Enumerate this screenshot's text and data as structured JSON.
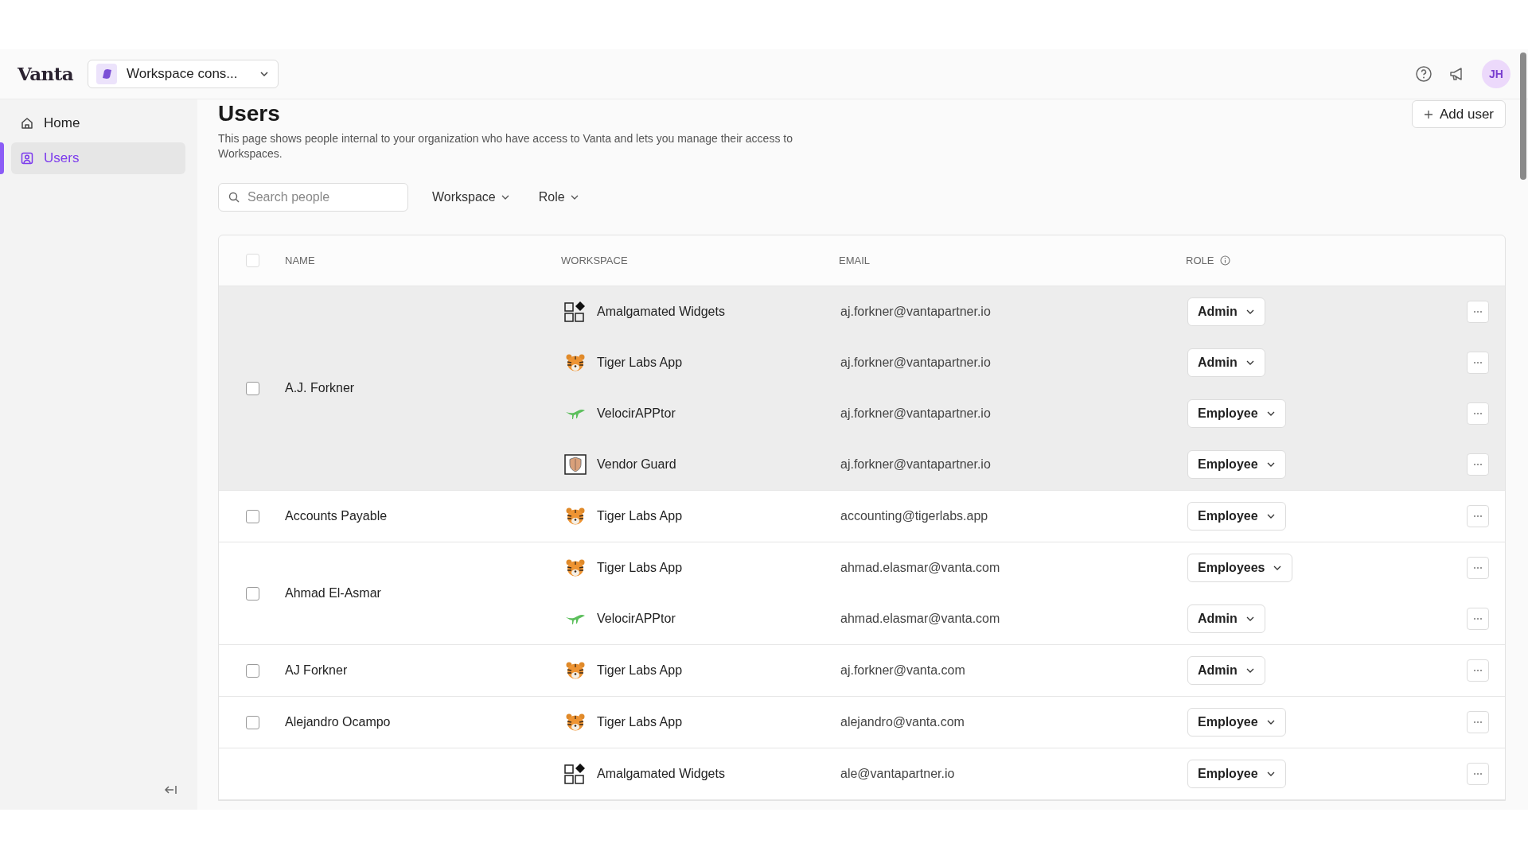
{
  "header": {
    "logo": "Vanta",
    "workspace": "Workspace cons...",
    "avatar": "JH"
  },
  "sidebar": {
    "items": [
      {
        "label": "Home",
        "kind": "home",
        "selected": false
      },
      {
        "label": "Users",
        "kind": "users",
        "selected": true
      }
    ]
  },
  "page": {
    "title": "Users",
    "description": "This page shows people internal to your organization who have access to Vanta and lets you manage their access to Workspaces.",
    "add_button": "Add user",
    "search": {
      "placeholder": "Search people"
    },
    "filters": [
      "Workspace",
      "Role"
    ]
  },
  "table": {
    "select_all": {
      "checked": false
    },
    "columns": [
      "NAME",
      "WORKSPACE",
      "EMAIL",
      "ROLE"
    ],
    "groups": [
      {
        "name": "A.J. Forkner",
        "checked": false,
        "highlighted": true,
        "memberships": [
          {
            "workspace": "Amalgamated Widgets",
            "kind": "grid",
            "email": "aj.forkner@vantapartner.io",
            "role": "Admin"
          },
          {
            "workspace": "Tiger Labs App",
            "kind": "tiger",
            "email": "aj.forkner@vantapartner.io",
            "role": "Admin"
          },
          {
            "workspace": "VelocirAPPtor",
            "kind": "raptor",
            "email": "aj.forkner@vantapartner.io",
            "role": "Employee"
          },
          {
            "workspace": "Vendor Guard",
            "kind": "shield",
            "email": "aj.forkner@vantapartner.io",
            "role": "Employee"
          }
        ]
      },
      {
        "name": "Accounts Payable",
        "checked": false,
        "highlighted": false,
        "memberships": [
          {
            "workspace": "Tiger Labs App",
            "kind": "tiger",
            "email": "accounting@tigerlabs.app",
            "role": "Employee"
          }
        ]
      },
      {
        "name": "Ahmad El-Asmar",
        "checked": false,
        "highlighted": false,
        "memberships": [
          {
            "workspace": "Tiger Labs App",
            "kind": "tiger",
            "email": "ahmad.elasmar@vanta.com",
            "role": "Employees"
          },
          {
            "workspace": "VelocirAPPtor",
            "kind": "raptor",
            "email": "ahmad.elasmar@vanta.com",
            "role": "Admin"
          }
        ]
      },
      {
        "name": "AJ Forkner",
        "checked": false,
        "highlighted": false,
        "memberships": [
          {
            "workspace": "Tiger Labs App",
            "kind": "tiger",
            "email": "aj.forkner@vanta.com",
            "role": "Admin"
          }
        ]
      },
      {
        "name": "Alejandro Ocampo",
        "checked": false,
        "highlighted": false,
        "memberships": [
          {
            "workspace": "Tiger Labs App",
            "kind": "tiger",
            "email": "alejandro@vanta.com",
            "role": "Employee"
          }
        ]
      },
      {
        "highlighted": false,
        "memberships": [
          {
            "workspace": "Amalgamated Widgets",
            "kind": "grid",
            "email": "ale@vantapartner.io",
            "role": "Employee"
          }
        ]
      }
    ]
  }
}
